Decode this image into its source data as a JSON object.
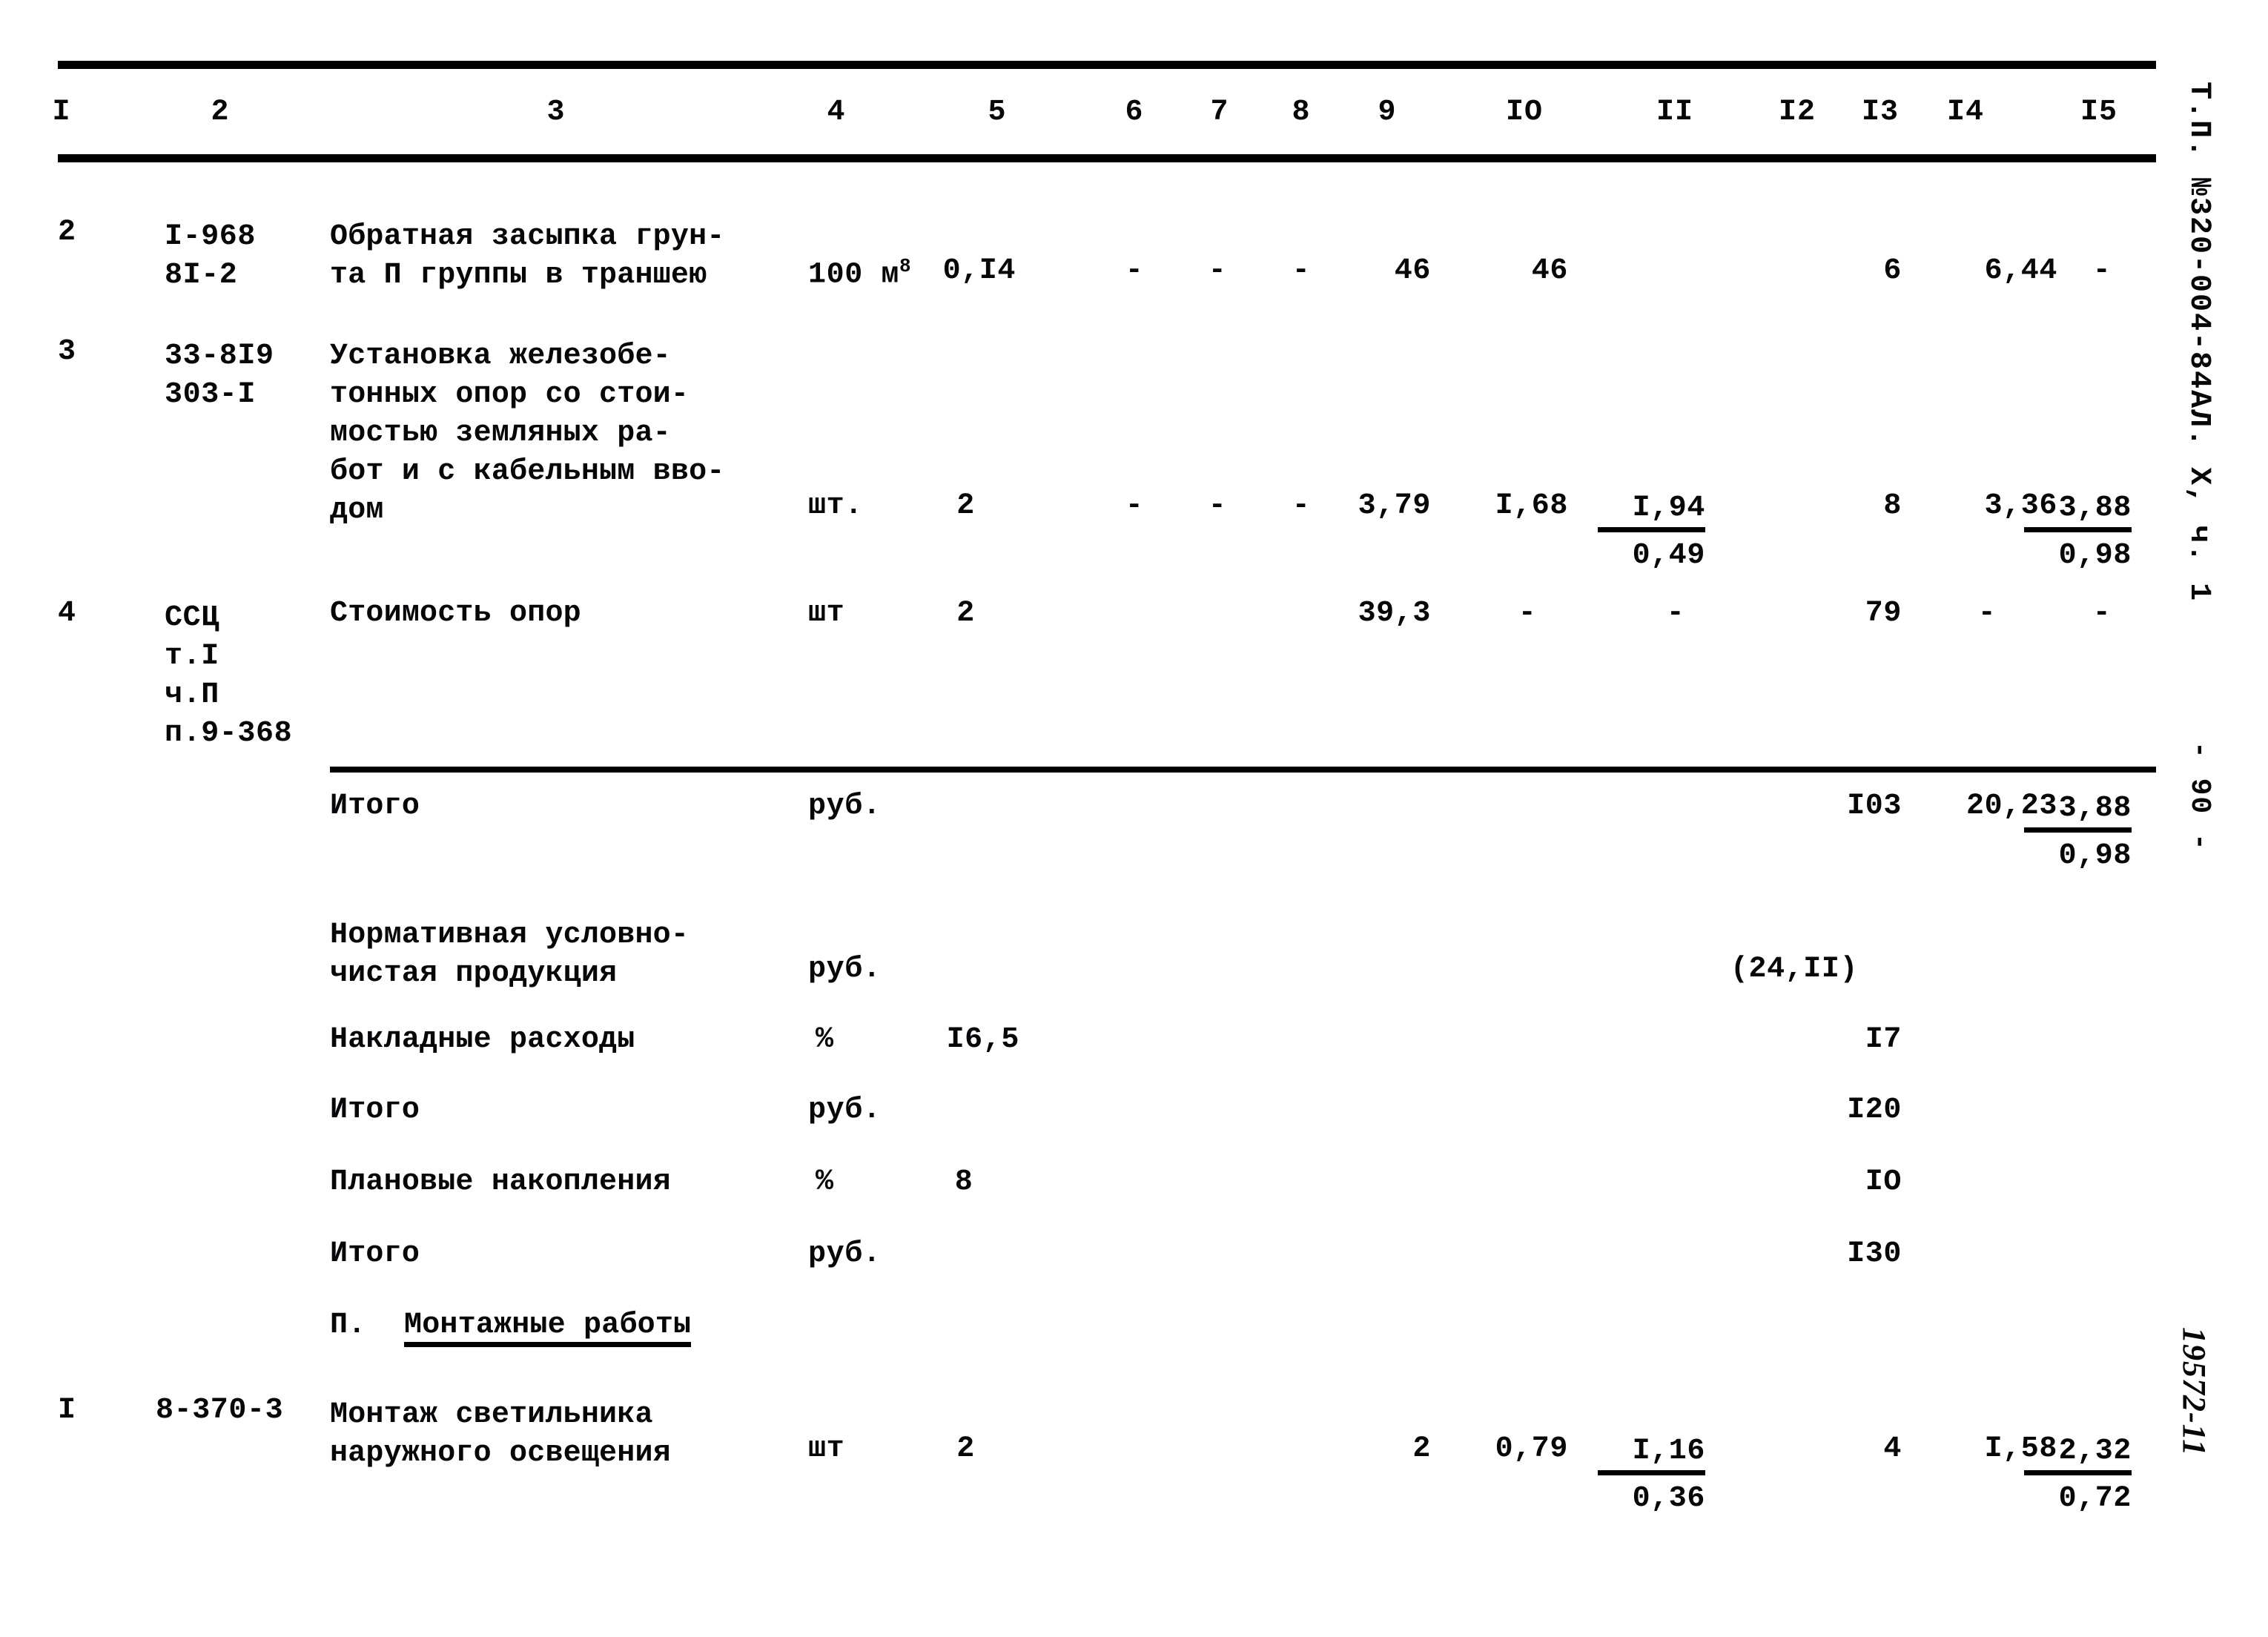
{
  "document": {
    "page_number": "- 90 -",
    "stamp": "Т.П. №320-004-84АЛ. Х, ч. 1",
    "handwritten_mark": "19572-11"
  },
  "table": {
    "column_headers": [
      "I",
      "2",
      "3",
      "4",
      "5",
      "6",
      "7",
      "8",
      "9",
      "IO",
      "II",
      "I2",
      "I3",
      "I4",
      "I5"
    ],
    "rows": [
      {
        "no": "2",
        "code": "I-968\n8I-2",
        "description": "Обратная засыпка грун-\nта П группы в траншею",
        "unit": "100 м",
        "unit_sup": "8",
        "qty": "0,I4",
        "c6": "-",
        "c7": "-",
        "c8": "-",
        "c9": "46",
        "c10": "46",
        "c11": "",
        "c12": "",
        "c13": "6",
        "c14": "6,44",
        "c15": "-"
      },
      {
        "no": "3",
        "code": "33-8I9\n303-I",
        "description": "Установка железобе-\nтонных опор со стои-\nмостью земляных ра-\nбот и с кабельным вво-\nдом",
        "unit": "шт.",
        "qty": "2",
        "c6": "-",
        "c7": "-",
        "c8": "-",
        "c9": "3,79",
        "c10": "I,68",
        "c11_top": "I,94",
        "c11_bot": "0,49",
        "c12": "",
        "c13": "8",
        "c14": "3,36",
        "c15_top": "3,88",
        "c15_bot": "0,98"
      },
      {
        "no": "4",
        "code": "ССЦ\nт.I\nч.П\nп.9-368",
        "description": "Стоимость опор",
        "unit": "шт",
        "qty": "2",
        "c9": "39,3",
        "c10": "-",
        "c11": "-",
        "c13": "79",
        "c14": "-",
        "c15": "-"
      }
    ],
    "summary": [
      {
        "label": "Итого",
        "unit": "руб.",
        "pct": "",
        "c13": "I03",
        "c14": "20,23",
        "c15_top": "3,88",
        "c15_bot": "0,98"
      },
      {
        "label": "Нормативная условно-\nчистая продукция",
        "unit": "руб.",
        "pct": "",
        "c12": "(24,II)"
      },
      {
        "label": "Накладные расходы",
        "unit": "%",
        "pct": "I6,5",
        "c13": "I7"
      },
      {
        "label": "Итого",
        "unit": "руб.",
        "pct": "",
        "c13": "I20"
      },
      {
        "label": "Плановые накопления",
        "unit": "%",
        "pct": "8",
        "c13": "IO"
      },
      {
        "label": "Итого",
        "unit": "руб.",
        "pct": "",
        "c13": "I30"
      }
    ],
    "section_heading": {
      "numeral": "П.",
      "title": "Монтажные работы"
    },
    "montage_rows": [
      {
        "no": "I",
        "code": "8-370-3",
        "description": "Монтаж светильника\nнаружного освещения",
        "unit": "шт",
        "qty": "2",
        "c9": "2",
        "c10": "0,79",
        "c11_top": "I,16",
        "c11_bot": "0,36",
        "c13": "4",
        "c14": "I,58",
        "c15_top": "2,32",
        "c15_bot": "0,72"
      }
    ]
  }
}
